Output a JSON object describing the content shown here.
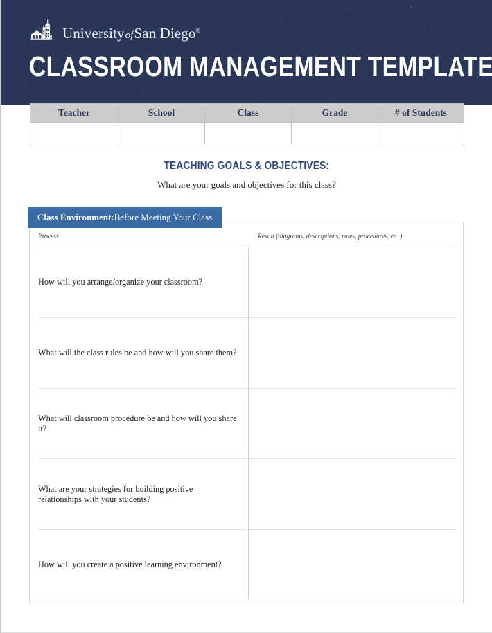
{
  "brand": {
    "logo_icon": "usd-mission-church-icon",
    "wordmark_university": "University",
    "wordmark_of": "of",
    "wordmark_place": "San Diego",
    "wordmark_tm": "®",
    "navy": "#2a3758",
    "banner_blue": "#3a6ba5",
    "heading_blue": "#2f4a85"
  },
  "header": {
    "title": "CLASSROOM MANAGEMENT TEMPLATE"
  },
  "info_table": {
    "columns": [
      "Teacher",
      "School",
      "Class",
      "Grade",
      "# of Students"
    ],
    "values": [
      "",
      "",
      "",
      "",
      ""
    ]
  },
  "goals": {
    "title": "TEACHING GOALS & OBJECTIVES:",
    "subtitle": "What are your goals and objectives for this class?"
  },
  "section": {
    "banner_bold": "Class Environment:",
    "banner_rest": " Before Meeting Your Class",
    "columns": {
      "process": "Process",
      "result": "Result (diagrams, descriptions, rules, procedures, etc.)"
    },
    "rows": [
      {
        "process": "How will you arrange/organize your classroom?",
        "result": ""
      },
      {
        "process": "What will the class rules be and how will you share them?",
        "result": ""
      },
      {
        "process": "What will classroom procedure be and how will you share it?",
        "result": ""
      },
      {
        "process": "What are your strategies for building positive relationships with your students?",
        "result": ""
      },
      {
        "process": "How will you create a positive learning environment?",
        "result": ""
      }
    ]
  }
}
